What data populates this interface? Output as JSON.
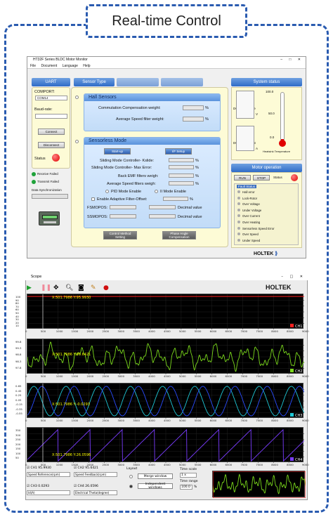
{
  "header": {
    "title": "Real-time Control"
  },
  "monitor": {
    "window_title": "HT32F Series BLDC Motor Monitor",
    "menu": [
      "File",
      "Document",
      "Language",
      "Help"
    ],
    "uart": {
      "tab": "UART",
      "comport_label": "COMPORT:",
      "comport_value": "COM14",
      "baud_label": "Baud-rate:",
      "connect": "Connect",
      "disconnect": "Disconnect",
      "status": "Status",
      "receive_failed": "Receive Failed",
      "transmit_failed": "Transmit Failed",
      "data_sync": "Data Synchronization"
    },
    "tabs": [
      "Sensor Type"
    ],
    "hall": {
      "title": "Hall Sensors",
      "comp_weight": "Commutation Compensation weight:",
      "avg_filter": "Average Speed filter weight:",
      "pct": "%"
    },
    "sensorless": {
      "title": "Sensorless Mode",
      "btn1": "Start-up",
      "btn2": "I/F Setup",
      "kslide": "Sliding Mode Controller- Kslide:",
      "maxerr": "Sliding Mode Controller- Max Error:",
      "bemf": "Back EMF filters weigh:",
      "avg": "Average Speed filters weigh:",
      "pid": "PID Mode Enable",
      "ii": "II Mode Enable",
      "adaptive": "Enable Adaptive Filter-Offset:",
      "fsmopos": "FSMOPOS:",
      "ssmopos": "SSMOPOS:",
      "decimal": "Decimal value",
      "pct": "%"
    },
    "bottom_btns": [
      "Control Method Setting",
      "Phase Angle Compensation"
    ],
    "system": {
      "title": "System status",
      "dc_voltage": "DC Bus Voltage",
      "dc_voltage_unit": "V",
      "dc_current": "DC Bus Current",
      "dc_current_unit": "A",
      "heatsink": "Heatsink Temperature",
      "ticks": [
        "100.0",
        "50.0",
        "0.0"
      ],
      "temp_fill": 0.05
    },
    "motor": {
      "title": "Motor operation",
      "run": "RUN",
      "stop": "STOP",
      "status": "Status",
      "fault_title": "Fault Status",
      "faults": [
        "Hall error",
        "Lock-Rotor",
        "Over Voltage",
        "Under Voltage",
        "Over Current",
        "Over Heating",
        "Sensorless Speed Error",
        "Over Speed",
        "Under Speed"
      ]
    },
    "brand": "HOLTEK"
  },
  "scope": {
    "window_title": "Scope",
    "brand": "HOLTEK",
    "cursor_labels": [
      "X:501.7986 Y:95.9930",
      "X:501.7986 Y:95.6421",
      "X:501.7986 Y:-0.0293",
      "X:501.7986 Y:26.0596"
    ],
    "channels": [
      "CH1",
      "CH2",
      "CH3",
      "CH4"
    ],
    "x_ticks": [
      "0",
      "500",
      "1000",
      "1500",
      "2000",
      "2500",
      "3000",
      "3500",
      "4000",
      "4500",
      "5000",
      "5500",
      "6000",
      "6500",
      "7000",
      "7500",
      "8000",
      "8500",
      "9000"
    ],
    "plot1_yticks": [
      "100",
      "90",
      "80",
      "70",
      "60",
      "50",
      "40",
      "30",
      "20",
      "10"
    ],
    "plot2_yticks": [
      "99.8",
      "99.3",
      "98.8",
      "98.3",
      "97.8"
    ],
    "plot3_yticks": [
      "0.65",
      "0.45",
      "0.25",
      "0.05",
      "-0.15",
      "-0.35",
      "-0.55"
    ],
    "plot4_yticks": [
      "350",
      "300",
      "250",
      "200",
      "150",
      "100",
      "50"
    ],
    "ch1_value": "95.9930",
    "ch2_value": "95.6421",
    "ch3_value": "0.0293",
    "ch4_value": "26.0596",
    "ch1_select": "Speed Reference(rpm)",
    "ch2_select": "Speed Feedback(rpm)",
    "ch3_select": "Id(A)",
    "ch4_select": "Electrical Theta(degree)",
    "layout_label": "Layout",
    "merge": "Merge window",
    "independent": "Independent windows",
    "timescale_label": "Time scale",
    "timescale_value": "1 x",
    "timerange_label": "Time range",
    "timerange_value": "100.0",
    "timerange_unit": "%",
    "colors": {
      "ch1": "#ff2020",
      "ch2": "#7bd91c",
      "ch3": "#1ec8d6",
      "ch4": "#7a3cff"
    }
  }
}
